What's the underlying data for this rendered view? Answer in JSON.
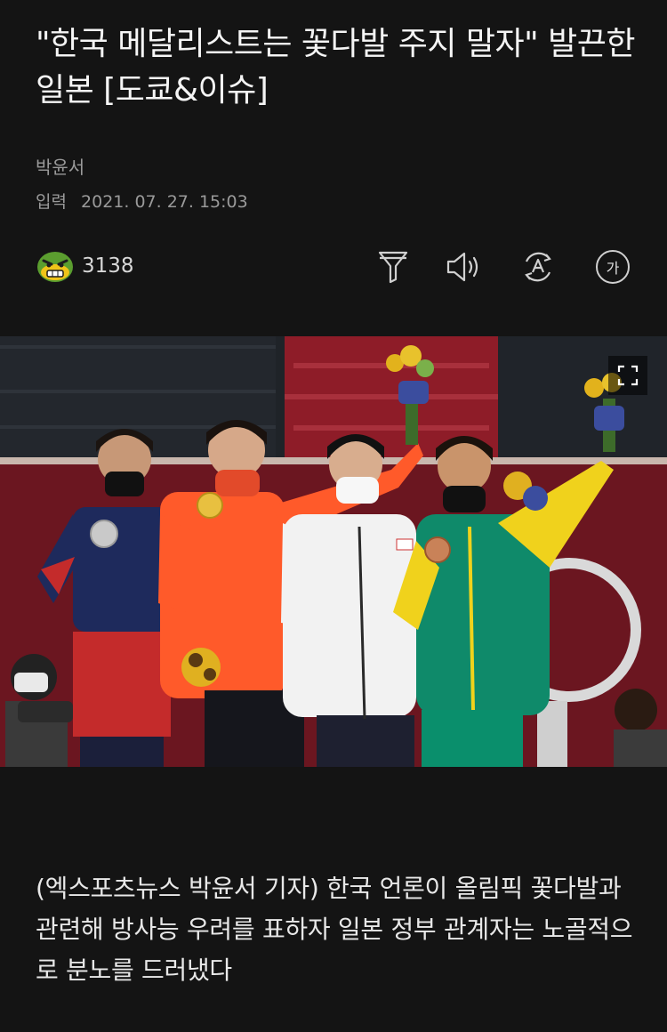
{
  "article": {
    "headline": "\"한국 메달리스트는 꽃다발 주지 말자\" 발끈한 일본 [도쿄&이슈]",
    "author": "박윤서",
    "date_label": "입력",
    "date": "2021. 07. 27. 15:03",
    "body": "(엑스포츠뉴스 박윤서 기자) 한국 언론이 올림픽 꽃다발과 관련해 방사능 우려를 표하자 일본 정부 관계자는 노골적으로 분노를 드러냈다"
  },
  "toolbar": {
    "reaction_icon": "angry-face-icon",
    "reaction_count": "3138",
    "filter_icon": "filter-icon",
    "tts_icon": "speaker-icon",
    "translate_icon": "translate-icon",
    "font_size_glyph": "가"
  },
  "photo": {
    "description_icon": "podium-photo",
    "expand_icon": "expand-icon"
  },
  "colors": {
    "background": "#141414",
    "text_primary": "#f5f5f5",
    "text_meta": "#9a9a9a"
  }
}
